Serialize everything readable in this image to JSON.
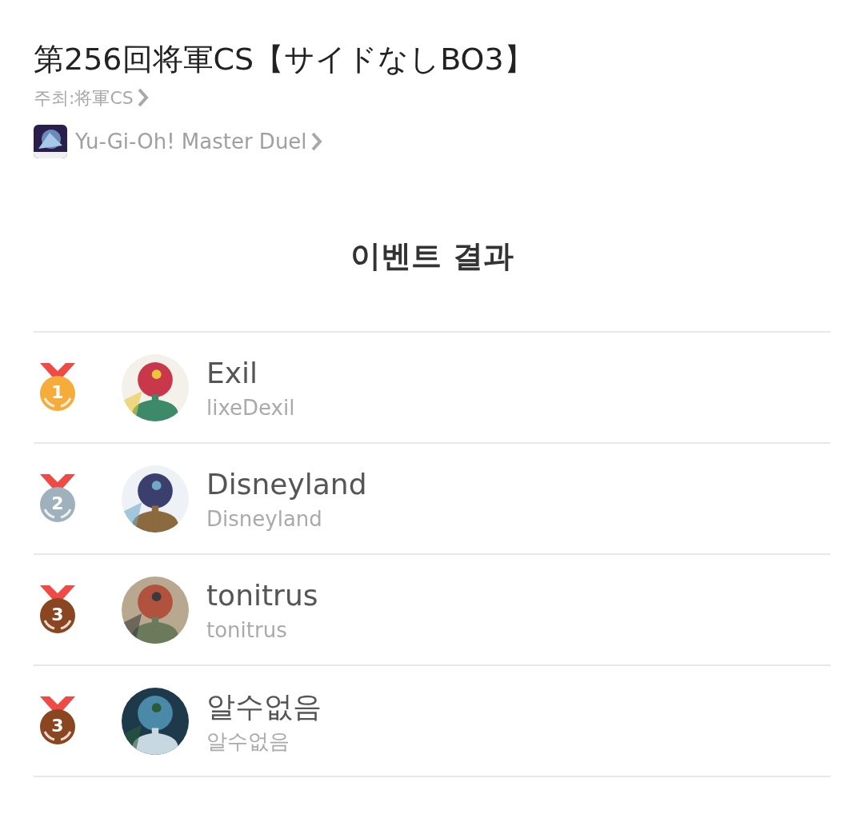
{
  "title": "第256回将軍CS【サイドなしBO3】",
  "host": {
    "label": "주최:将軍CS"
  },
  "game": {
    "name": "Yu-Gi-Oh! Master Duel"
  },
  "section_title": "이벤트 결과",
  "results": [
    {
      "rank": "1",
      "color": "#f5ac3b",
      "name": "Exil",
      "username": "lixeDexil"
    },
    {
      "rank": "2",
      "color": "#9fb1bc",
      "name": "Disneyland",
      "username": "Disneyland"
    },
    {
      "rank": "3",
      "color": "#8a4620",
      "name": "tonitrus",
      "username": "tonitrus"
    },
    {
      "rank": "3",
      "color": "#8a4620",
      "name": "알수없음",
      "username": "알수없음"
    }
  ]
}
